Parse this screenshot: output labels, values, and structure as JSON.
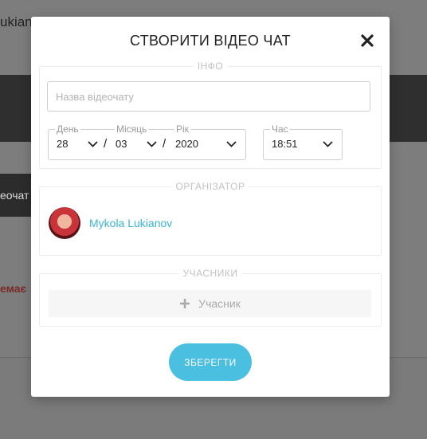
{
  "background": {
    "header_text": "ukian",
    "tab_text": "еочат",
    "red_text": "емає"
  },
  "modal": {
    "title": "СТВОРИТИ ВІДЕО ЧАТ",
    "info": {
      "legend": "ІНФО",
      "name_placeholder": "Назва відеочату",
      "name_value": "",
      "day_label": "День",
      "day_value": "28",
      "month_label": "Місяць",
      "month_value": "03",
      "year_label": "Рік",
      "year_value": "2020",
      "separator": "/",
      "time_label": "Час",
      "time_value": "18:51"
    },
    "organizer": {
      "legend": "ОРГАНІЗАТОР",
      "name": "Mykola Lukianov"
    },
    "participants": {
      "legend": "УЧАСНИКИ",
      "add_label": "Учасник"
    },
    "save_label": "ЗБЕРЕГТИ"
  },
  "icons": {
    "close": "close-icon",
    "chevron": "chevron-down-icon",
    "plus": "plus-icon"
  },
  "colors": {
    "accent": "#4bbfe0",
    "link": "#3bb4d6",
    "overlay": "#7f7f7f"
  }
}
